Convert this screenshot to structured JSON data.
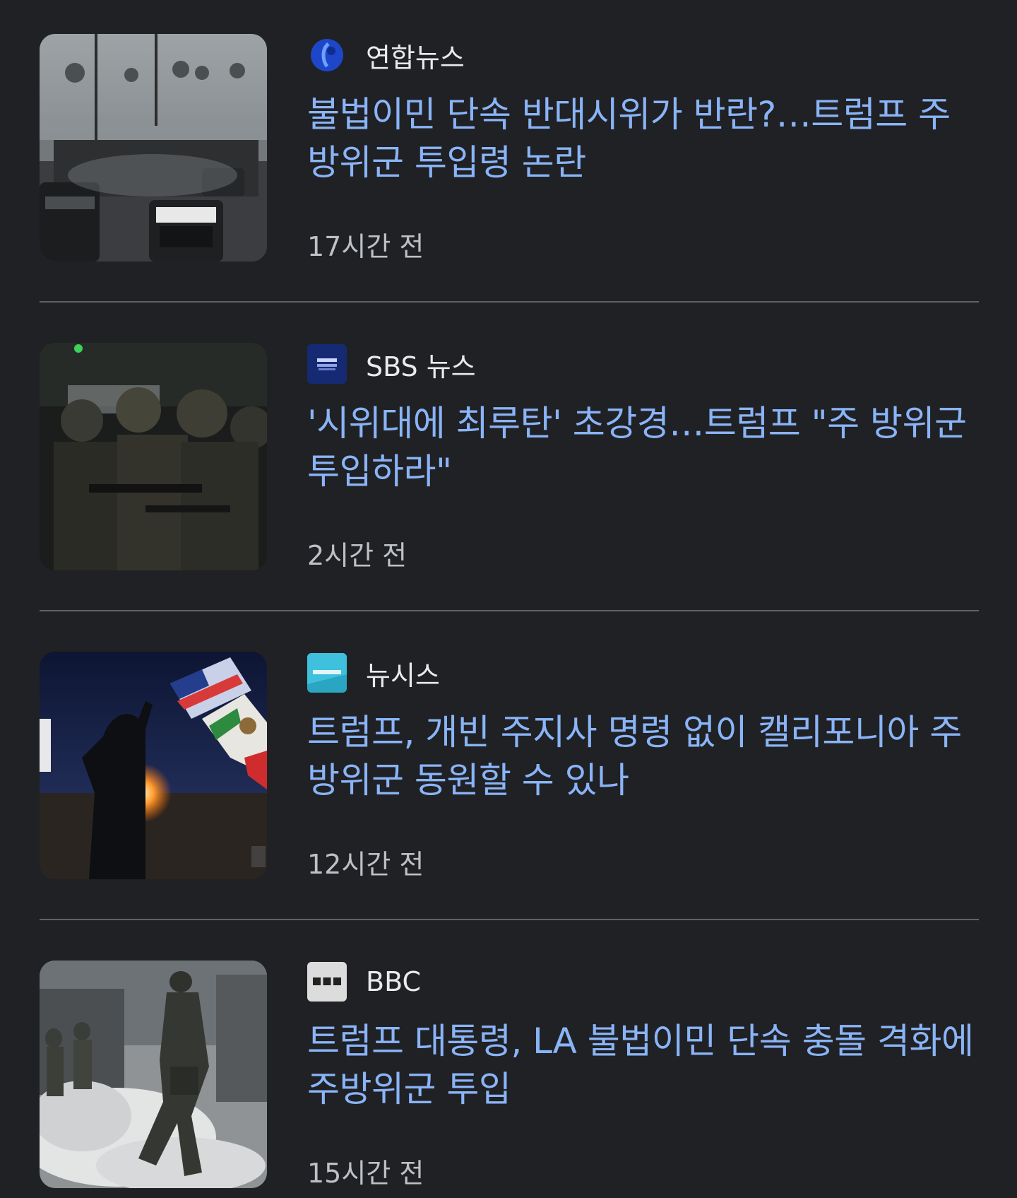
{
  "colors": {
    "background": "#202124",
    "headline": "#8ab4f8",
    "source_text": "#e8eaed",
    "time_text": "#bdc1c6",
    "divider": "#5f6368"
  },
  "articles": [
    {
      "source": "연합뉴스",
      "source_logo": "yonhap-logo-icon",
      "headline": "불법이민 단속 반대시위가 반란?…트럼프 주방위군 투입령 논란",
      "time": "17시간 전",
      "thumbnail": "protest-street-police-cars-image"
    },
    {
      "source": "SBS 뉴스",
      "source_logo": "sbs-news-logo-icon",
      "headline": "'시위대에 최루탄' 초강경…트럼프 \"주 방위군 투입하라\"",
      "time": "2시간 전",
      "thumbnail": "armed-troops-night-image"
    },
    {
      "source": "뉴시스",
      "source_logo": "newsis-logo-icon",
      "headline": "트럼프, 개빈 주지사 명령 없이 캘리포니아 주방위군 동원할 수 있나",
      "time": "12시간 전",
      "thumbnail": "flag-protester-fire-image"
    },
    {
      "source": "BBC",
      "source_logo": "bbc-logo-icon",
      "headline": "트럼프 대통령, LA 불법이민 단속 충돌 격화에 주방위군 투입",
      "time": "15시간 전",
      "thumbnail": "soldier-tear-gas-image"
    }
  ]
}
